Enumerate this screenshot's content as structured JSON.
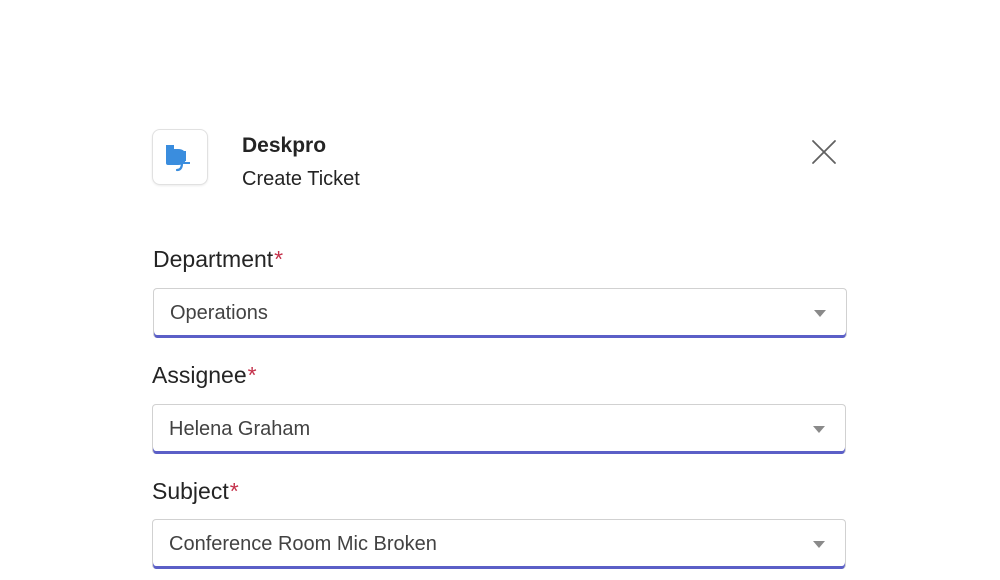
{
  "header": {
    "app_name": "Deskpro",
    "subtitle": "Create Ticket",
    "logo_icon": "deskpro-logo-icon",
    "close_icon": "close-icon",
    "brand_color": "#3a8dde"
  },
  "form": {
    "required_marker": "*",
    "accent_color": "#5b5fc7",
    "required_color": "#c4314b",
    "fields": [
      {
        "label": "Department",
        "value": "Operations",
        "required": true
      },
      {
        "label": "Assignee",
        "value": "Helena Graham",
        "required": true
      },
      {
        "label": "Subject",
        "value": "Conference Room Mic Broken",
        "required": true
      }
    ]
  }
}
